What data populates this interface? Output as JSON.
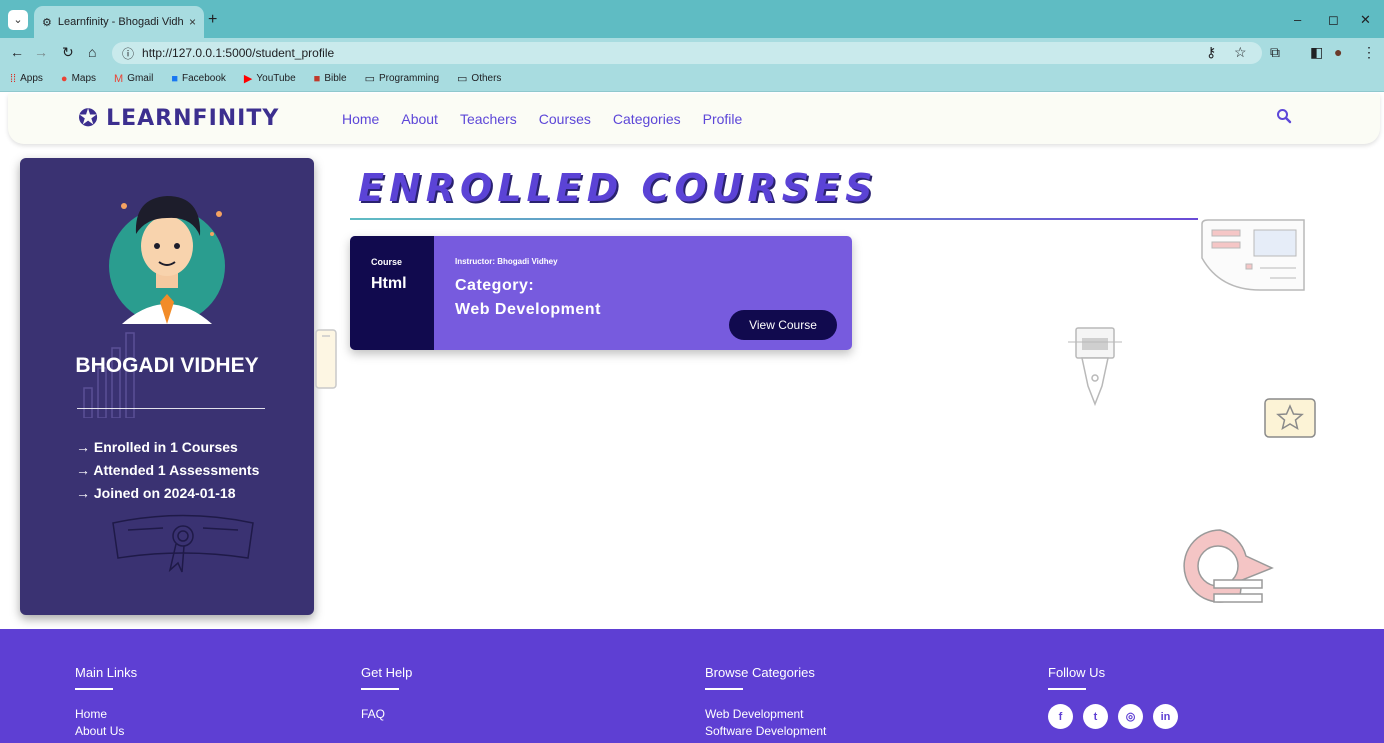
{
  "browser": {
    "tab_title": "Learnfinity - Bhogadi Vidhey",
    "new_tab": "+",
    "close_tab": "×",
    "url": "http://127.0.0.1:5000/student_profile",
    "bookmarks": [
      {
        "label": "Apps",
        "icon": "apps-grid-icon"
      },
      {
        "label": "Maps",
        "icon": "maps-pin-icon"
      },
      {
        "label": "Gmail",
        "icon": "gmail-icon"
      },
      {
        "label": "Facebook",
        "icon": "facebook-icon"
      },
      {
        "label": "YouTube",
        "icon": "youtube-icon"
      },
      {
        "label": "Bible",
        "icon": "bible-icon"
      },
      {
        "label": "Programming",
        "icon": "folder-icon"
      },
      {
        "label": "Others",
        "icon": "folder-icon"
      }
    ]
  },
  "header": {
    "brand": "LEARNFINITY",
    "nav": [
      "Home",
      "About",
      "Teachers",
      "Courses",
      "Categories",
      "Profile"
    ]
  },
  "profile": {
    "name": "BHOGADI VIDHEY",
    "stats": [
      "→ Enrolled in 1 Courses",
      "→ Attended 1 Assessments",
      "→ Joined on 2024-01-18"
    ]
  },
  "enrolled": {
    "title": "ENROLLED COURSES",
    "courses": [
      {
        "kicker": "Course",
        "name": "Html",
        "instructor": "Instructor: Bhogadi Vidhey",
        "category_label": "Category:",
        "category": "Web Development",
        "button": "View Course"
      }
    ]
  },
  "footer": {
    "columns": [
      {
        "heading": "Main Links",
        "links": [
          "Home",
          "About Us"
        ]
      },
      {
        "heading": "Get Help",
        "links": [
          "FAQ"
        ]
      },
      {
        "heading": "Browse Categories",
        "links": [
          "Web Development",
          "Software Development"
        ]
      },
      {
        "heading": "Follow Us",
        "links": []
      }
    ],
    "socials": [
      {
        "name": "facebook",
        "glyph": "f"
      },
      {
        "name": "twitter",
        "glyph": "t"
      },
      {
        "name": "instagram",
        "glyph": "◎"
      },
      {
        "name": "linkedin",
        "glyph": "in"
      }
    ]
  },
  "colors": {
    "primary": "#5e3fd3",
    "card_dark": "#3a3272",
    "course_card": "#775bde",
    "course_side": "#110a4e",
    "browser_teal": "#5fbcc3"
  }
}
